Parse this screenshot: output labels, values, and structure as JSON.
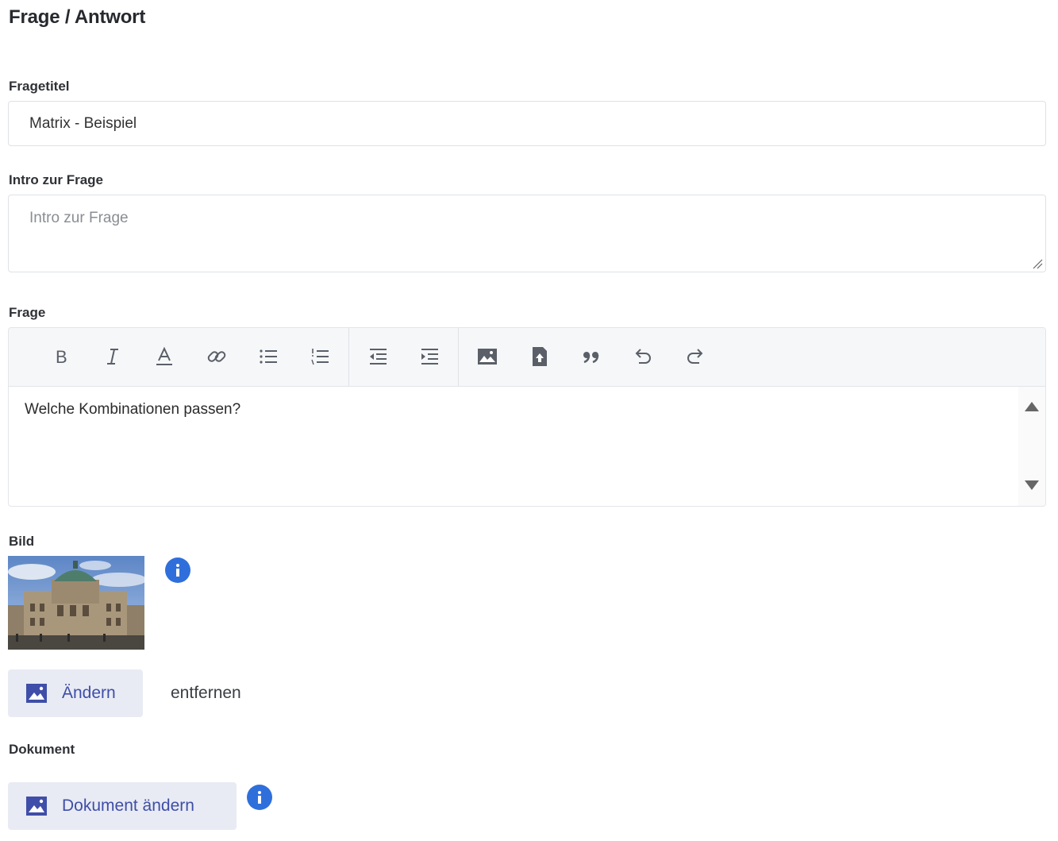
{
  "section": {
    "title": "Frage / Antwort"
  },
  "fields": {
    "title": {
      "label": "Fragetitel",
      "value": "Matrix - Beispiel"
    },
    "intro": {
      "label": "Intro zur Frage",
      "placeholder": "Intro zur Frage"
    },
    "question": {
      "label": "Frage",
      "content": "Welche Kombinationen passen?"
    },
    "image": {
      "label": "Bild",
      "change_label": "Ändern",
      "remove_label": "entfernen"
    },
    "document": {
      "label": "Dokument",
      "change_label": "Dokument ändern"
    }
  },
  "toolbar": {
    "buttons": [
      "bold-icon",
      "italic-icon",
      "font-color-icon",
      "link-icon",
      "bulleted-list-icon",
      "numbered-list-icon",
      "outdent-icon",
      "indent-icon",
      "image-icon",
      "file-upload-icon",
      "blockquote-icon",
      "undo-icon",
      "redo-icon"
    ]
  },
  "colors": {
    "accent": "#3f4ea8",
    "info": "#2f6fdc",
    "button_bg": "#e8ebf3"
  }
}
